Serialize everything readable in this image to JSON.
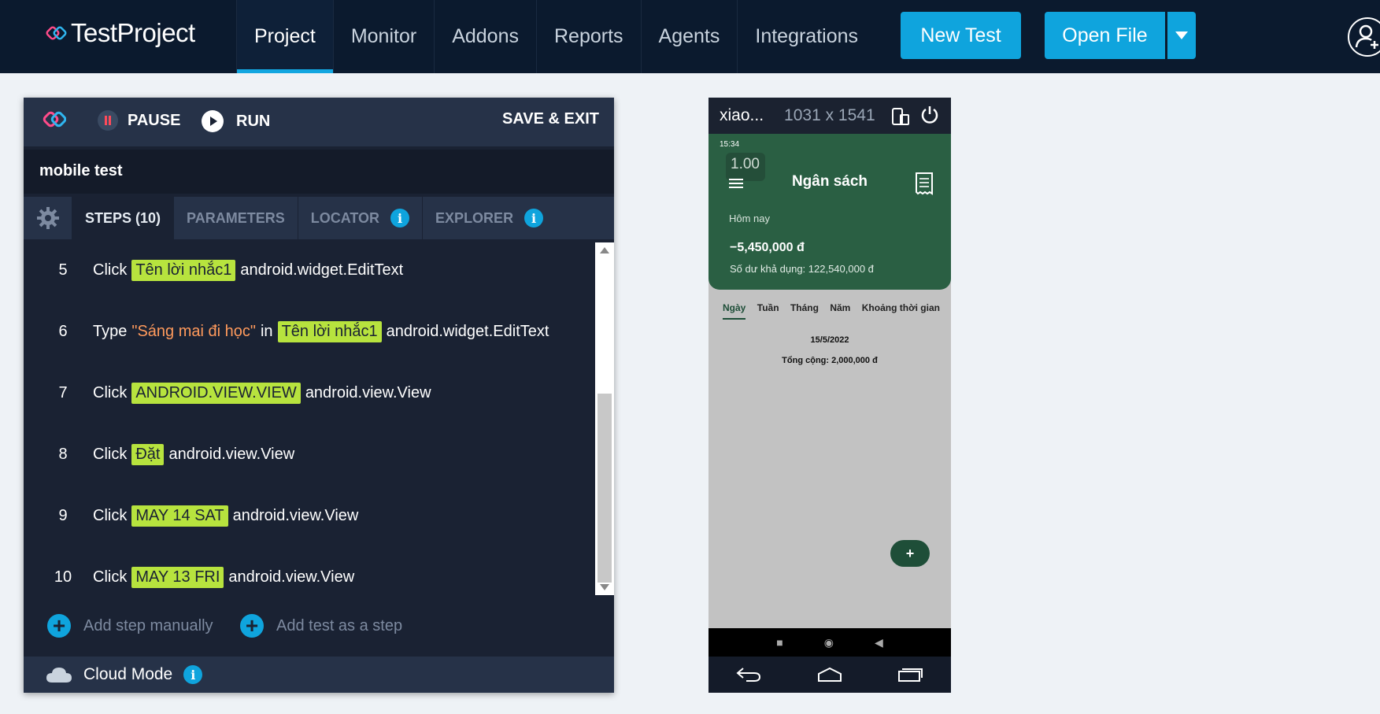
{
  "topnav": {
    "logo_text": "TestProject",
    "tabs": [
      "Project",
      "Monitor",
      "Addons",
      "Reports",
      "Agents",
      "Integrations"
    ],
    "active_tab": "Project",
    "new_test_label": "New Test",
    "open_file_label": "Open File"
  },
  "recorder": {
    "pause_label": "PAUSE",
    "run_label": "RUN",
    "save_exit_label": "SAVE & EXIT",
    "test_name": "mobile test",
    "tabs": {
      "steps": "STEPS (10)",
      "parameters": "PARAMETERS",
      "locator": "LOCATOR",
      "explorer": "EXPLORER"
    },
    "steps": [
      {
        "num": "5",
        "action": "Click",
        "element": "Tên lời nhắc1",
        "type": "android.widget.EditText"
      },
      {
        "num": "6",
        "action": "Type",
        "value": "\"Sáng mai đi học\"",
        "in": "in",
        "element": "Tên lời nhắc1",
        "type": "android.widget.EditText"
      },
      {
        "num": "7",
        "action": "Click",
        "element": "ANDROID.VIEW.VIEW",
        "type": "android.view.View"
      },
      {
        "num": "8",
        "action": "Click",
        "element": "Đặt",
        "type": "android.view.View"
      },
      {
        "num": "9",
        "action": "Click",
        "element": "MAY 14 SAT",
        "type": "android.view.View"
      },
      {
        "num": "10",
        "action": "Click",
        "element": "MAY 13 FRI",
        "type": "android.view.View"
      }
    ],
    "add_step_label": "Add step manually",
    "add_test_label": "Add test as a step",
    "cloud_mode_label": "Cloud Mode"
  },
  "device": {
    "name": "xiao...",
    "resolution": "1031 x 1541",
    "status_time": "15:34",
    "zoom": "1.00",
    "app_title": "Ngân sách",
    "today_label": "Hôm nay",
    "amount": "−5,450,000 đ",
    "balance": "Số dư khả dụng: 122,540,000 đ",
    "period_tabs": [
      "Ngày",
      "Tuần",
      "Tháng",
      "Năm",
      "Khoảng thời gian"
    ],
    "active_period": "Ngày",
    "date": "15/5/2022",
    "total": "Tổng cộng: 2,000,000 đ",
    "fab_label": "+",
    "nav_square": "■",
    "nav_circle": "◉",
    "nav_back": "◀"
  },
  "colors": {
    "nav_bg": "#0b1a2e",
    "accent_blue": "#0fa4dd",
    "highlight_green": "#b7e33e",
    "string_orange": "#ff9a5c",
    "app_green": "#2a5f43"
  }
}
